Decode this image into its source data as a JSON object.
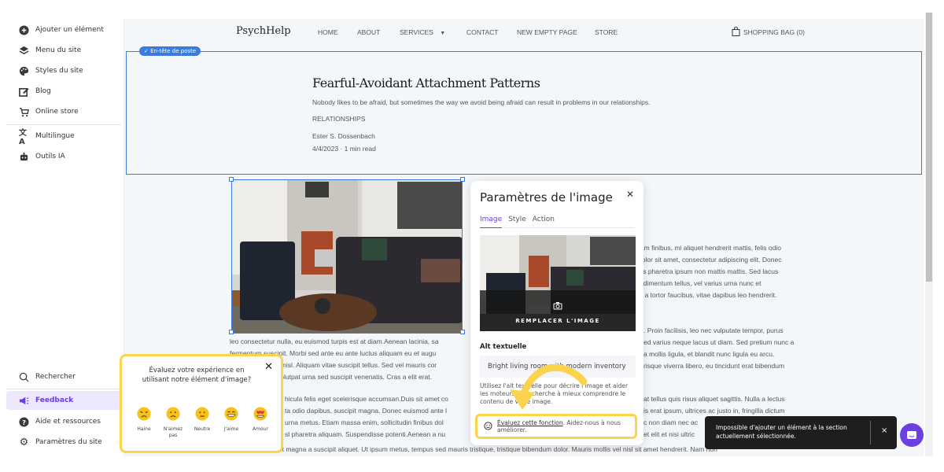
{
  "sidebar": {
    "top_items": [
      {
        "label": "Ajouter un élément",
        "icon": "plus-circle-icon"
      },
      {
        "label": "Menu du site",
        "icon": "layers-icon"
      },
      {
        "label": "Styles du site",
        "icon": "palette-icon"
      },
      {
        "label": "Blog",
        "icon": "edit-icon"
      },
      {
        "label": "Online store",
        "icon": "cart-icon"
      },
      {
        "label": "Multilingue",
        "icon": "translate-icon"
      },
      {
        "label": "Outils IA",
        "icon": "robot-icon"
      }
    ],
    "bottom_items": [
      {
        "label": "Rechercher",
        "icon": "search-icon"
      },
      {
        "label": "Feedback",
        "icon": "megaphone-icon",
        "active": true
      },
      {
        "label": "Aide et ressources",
        "icon": "help-icon"
      },
      {
        "label": "Paramètres du site",
        "icon": "gear-icon"
      }
    ]
  },
  "site": {
    "brand": "PsychHelp",
    "nav": [
      "HOME",
      "ABOUT",
      "SERVICES",
      "CONTACT",
      "NEW EMPTY PAGE",
      "STORE"
    ],
    "bag": "SHOPPING BAG (0)"
  },
  "header_section": {
    "badge": "✓ En-tête de poste",
    "title": "Fearful-Avoidant Attachment Patterns",
    "subtitle": "Nobody likes to be afraid, but sometimes the way we avoid being afraid can result in problems in our relationships.",
    "category": "RELATIONSHIPS",
    "author": "Ester S. Dossenbach",
    "date": "4/4/2023 · 1 min read"
  },
  "body": {
    "right_col_1": [
      "Etiam finibus, mi aliquet hendrerit mattis, felis odio",
      "n dolor sit amet, consectetur adipiscing elit. Donec",
      "ellus pharetra ipsum non mattis mattis. Sed lacus",
      "condimentum tellus, vel varius urna nunc et",
      "cus a tortor faucibus, vitae dapibus leo hendrerit."
    ],
    "para2_left": [
      "leo consectetur nulla, eu euismod turpis est at diam.Aenean lacinia, sa",
      "fermentum suscipit. Morbi sed ante eu ante luctus aliquam eu et augu",
      "a nisl. Aliquam vitae suscipit tellus. Sed vel mauris cor",
      "volutpat urna sed suscipit venenatis. Cras a elit erat."
    ],
    "para2_right": [
      ". Proin facilisis, leo nec vulputate tempor, purus",
      "ed varius neque lacus ut diam. Sed pretium nunc a",
      "a mollis ligula, et blandit nunc ligula eu arcu.",
      "risque viverra libero, eu tincidunt erat bibendum"
    ],
    "para3_left": [
      "hicula felis eget scelerisque accumsan.Duis sit amet co",
      "ta odio dapibus, suscipit magna. Donec euismod ante l",
      "urna metus. Etiam massa enim, sollicitudin finibus dol",
      "sl pharetra aliquam. Suspendisse potenti.Aenean a nu"
    ],
    "para3_right": [
      "at tellus quis risus aliquet sagittis. Nulla a lectus",
      "is erat ipsum, ultrices ac justo in, fringilla dictum",
      "c non diam nec ac",
      "et elit et nisi ultric"
    ],
    "last_line": "leo. Cras nenc erit magna a suscipit aliquet. Ut ipsum metus, tempus sed mauris tristique, tristique bibendum dolor. Mauris mollis vel nisl sit amet hendrerit. Nam non"
  },
  "image_panel": {
    "title": "Paramètres de l'image",
    "tabs": [
      "Image",
      "Style",
      "Action"
    ],
    "active_tab": "Image",
    "replace_label": "REMPLACER L'IMAGE",
    "alt_label": "Alt textuelle",
    "alt_value": "Bright living room with modern inventory",
    "alt_help": "Utilisez l'alt textuelle pour décrire l'image et aider les moteurs de recherche à mieux comprendre le contenu de votre image.",
    "rate_link": "Évaluez cette fonction",
    "rate_text": ". Aidez-nous à nous améliorer."
  },
  "feedback_popup": {
    "question": "Évaluez votre expérience en utilisant notre élément d'image?",
    "options": [
      {
        "label": "Haine",
        "face": "angry"
      },
      {
        "label": "N'aimez pas",
        "face": "sad"
      },
      {
        "label": "Neutre",
        "face": "neutral"
      },
      {
        "label": "J'aime",
        "face": "grin"
      },
      {
        "label": "Amour",
        "face": "heart-eyes"
      }
    ]
  },
  "toast": {
    "message": "Impossible d'ajouter un élément à la section actuellement sélectionnée.",
    "close": "×"
  },
  "colors": {
    "accent": "#6b3fe0",
    "selection": "#3a7be0",
    "highlight": "#fcd34d",
    "toast_bg": "#1e1e1e"
  }
}
